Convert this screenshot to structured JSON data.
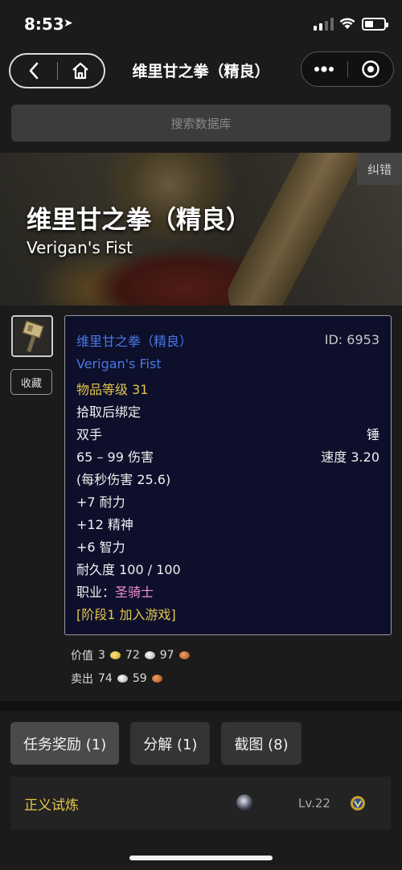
{
  "status_bar": {
    "time": "8:53",
    "location_glyph": "➤"
  },
  "nav": {
    "title": "维里甘之拳（精良）",
    "back_glyph": "〈",
    "more_glyph": "•••"
  },
  "search": {
    "placeholder": "搜索数据库"
  },
  "banner": {
    "title": "维里甘之拳（精良）",
    "subtitle": "Verigan's Fist",
    "report_label": "纠错"
  },
  "item": {
    "favorite_label": "收藏",
    "name_cn": "维里甘之拳（精良）",
    "id_label": "ID: 6953",
    "name_en": "Verigan's Fist",
    "item_level": "物品等级 31",
    "binding": "拾取后绑定",
    "slot": "双手",
    "type": "锤",
    "damage": "65 – 99 伤害",
    "speed": "速度 3.20",
    "dps": "(每秒伤害 25.6)",
    "stats": [
      "+7 耐力",
      "+12 精神",
      "+6 智力"
    ],
    "durability": "耐久度 100 / 100",
    "class_label": "职业：",
    "class_value": "圣骑士",
    "phase": "[阶段1 加入游戏]"
  },
  "value": {
    "label": "价值",
    "gold": "3",
    "silver": "72",
    "copper": "97"
  },
  "sell": {
    "label": "卖出",
    "silver": "74",
    "copper": "59"
  },
  "tabs": [
    {
      "label": "任务奖励 (1)",
      "active": true
    },
    {
      "label": "分解 (1)",
      "active": false
    },
    {
      "label": "截图 (8)",
      "active": false
    }
  ],
  "quest_row": {
    "name": "正义试炼",
    "level": "Lv.22"
  },
  "colors": {
    "tooltip_bg": "#0d0f2b",
    "rare_blue": "#4a78e6",
    "gold_text": "#e3c64a",
    "paladin_pink": "#f08ed8"
  }
}
